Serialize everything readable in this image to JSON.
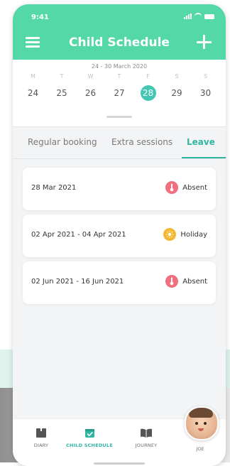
{
  "status_bar": {
    "time": "9:41"
  },
  "header": {
    "title": "Child Schedule",
    "menu_icon": "hamburger-menu-icon",
    "add_icon": "plus-icon",
    "color": "#54d8a8"
  },
  "calendar": {
    "range": "24 - 30 March 2020",
    "days": [
      {
        "label": "M",
        "date": "24"
      },
      {
        "label": "T",
        "date": "25"
      },
      {
        "label": "W",
        "date": "26"
      },
      {
        "label": "T",
        "date": "27"
      },
      {
        "label": "F",
        "date": "28"
      },
      {
        "label": "S",
        "date": "29"
      },
      {
        "label": "S",
        "date": "30"
      }
    ],
    "selected_date": "28",
    "accent": "#44c6b5"
  },
  "tabs": [
    {
      "label": "Regular booking"
    },
    {
      "label": "Extra sessions"
    },
    {
      "label": "Leave"
    }
  ],
  "active_tab": "Leave",
  "leave_entries": [
    {
      "date": "28 Mar 2021",
      "status": "Absent",
      "icon": "thermometer-icon",
      "color": "#f0707f"
    },
    {
      "date": "02 Apr 2021 - 04 Apr 2021",
      "status": "Holiday",
      "icon": "sun-icon",
      "color": "#f5b731"
    },
    {
      "date": "02 Jun 2021 - 16 Jun 2021",
      "status": "Absent",
      "icon": "thermometer-icon",
      "color": "#f0707f"
    }
  ],
  "bottom_nav": {
    "items": [
      {
        "label": "DIARY",
        "icon": "diary-icon"
      },
      {
        "label": "CHILD SCHEDULE",
        "icon": "schedule-checkbox-icon"
      },
      {
        "label": "JOURNEY",
        "icon": "journey-book-icon"
      }
    ],
    "profile_label": "JOE",
    "active": "CHILD SCHEDULE"
  }
}
